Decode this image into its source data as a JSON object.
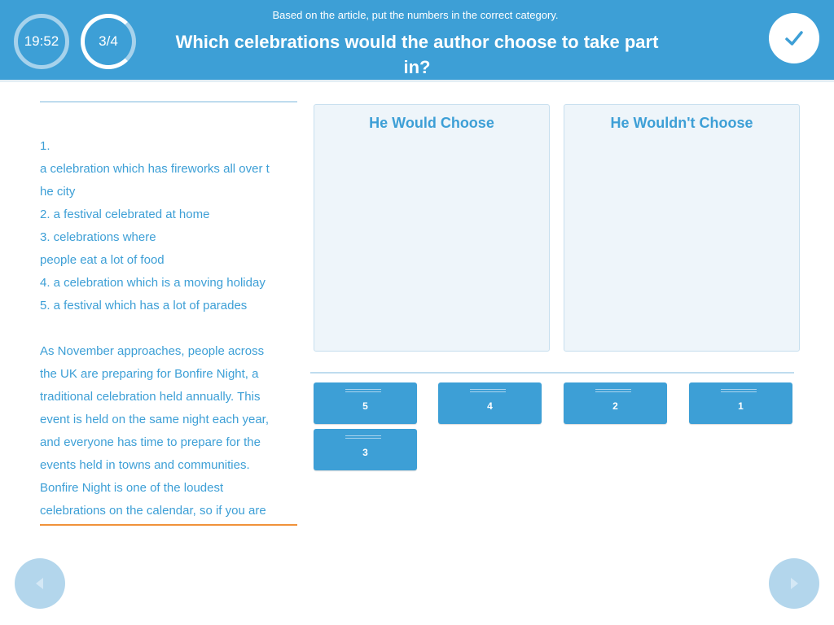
{
  "header": {
    "timer": "19:52",
    "progress": "3/4",
    "progress_fraction": 0.75,
    "instruction": "Based on the article, put the numbers in the correct category.",
    "question": "Which celebrations would the author choose to take part in?",
    "submit_icon": "checkmark-icon"
  },
  "reading": {
    "lines": [
      "1.",
      "a celebration which has fireworks all over t",
      "he city",
      "2. a festival celebrated at home",
      "3. celebrations where",
      "people eat a lot of food",
      "4. a celebration which is a moving holiday",
      "5. a festival which has a lot of parades"
    ],
    "article": [
      "As November approaches, people across",
      "the UK are preparing for Bonfire Night, a",
      "traditional celebration held annually. This",
      "event is held on the same night each year,",
      "and everyone has time to prepare for the",
      "events held in towns and communities.",
      "Bonfire Night is one of the loudest",
      "celebrations on the calendar, so if you are"
    ]
  },
  "categories": [
    {
      "title": "He Would Choose"
    },
    {
      "title": "He Wouldn't Choose"
    }
  ],
  "chips": [
    "5",
    "4",
    "2",
    "1",
    "3"
  ],
  "nav": {
    "prev_icon": "arrow-left-icon",
    "next_icon": "arrow-right-icon"
  },
  "colors": {
    "accent": "#3d9fd6",
    "accent_light": "#b3d6ec",
    "highlight_line": "#f0923a"
  }
}
